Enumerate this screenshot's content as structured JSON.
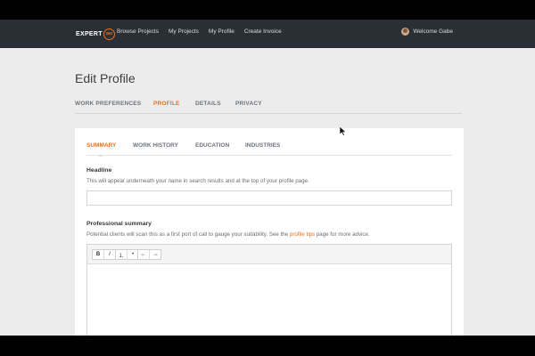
{
  "nav": {
    "logo_text": "EXPERT",
    "logo_badge": "360",
    "links": [
      "Browse Projects",
      "My Projects",
      "My Profile",
      "Create Invoice"
    ],
    "welcome": "Welcome Gabe"
  },
  "page": {
    "title": "Edit Profile",
    "tabs": [
      "WORK PREFERENCES",
      "PROFILE",
      "DETAILS",
      "PRIVACY"
    ],
    "active_tab": "PROFILE"
  },
  "card": {
    "sub_tabs": [
      "SUMMARY",
      "WORK HISTORY",
      "EDUCATION",
      "INDUSTRIES"
    ],
    "active_sub_tab": "SUMMARY",
    "headline": {
      "label": "Headline",
      "hint": "This will appear underneath your name in search results and at the top of your profile page.",
      "value": ""
    },
    "summary": {
      "label": "Professional summary",
      "hint_before": "Potential clients will scan this as a first port of call to gauge your suitability. See the ",
      "hint_link": "profile tips",
      "hint_after": " page for more advice."
    },
    "toolbar": {
      "bold": "B",
      "italic": "I",
      "ordered_list": "⒈",
      "unordered_list": "•",
      "outdent": "⇤",
      "indent": "⇥"
    }
  },
  "colors": {
    "accent": "#e8701a",
    "nav_bg": "#2a2f36",
    "page_bg": "#ececec"
  }
}
